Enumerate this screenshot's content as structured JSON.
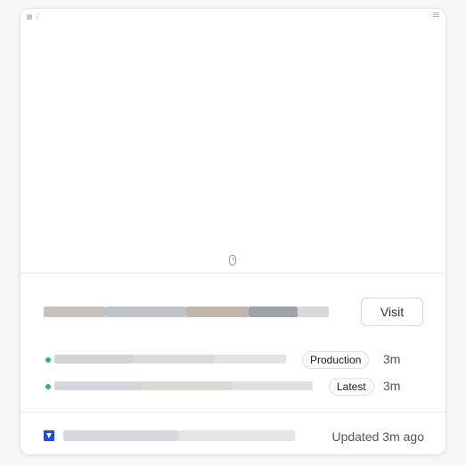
{
  "card": {
    "action_label": "Visit",
    "deployments": [
      {
        "environment": "Production",
        "age": "3m",
        "status_color": "#2bb673"
      },
      {
        "environment": "Latest",
        "age": "3m",
        "status_color": "#2bb673"
      }
    ],
    "footer": {
      "updated_text": "Updated 3m ago",
      "logo_color": "#1d4ed8"
    }
  }
}
